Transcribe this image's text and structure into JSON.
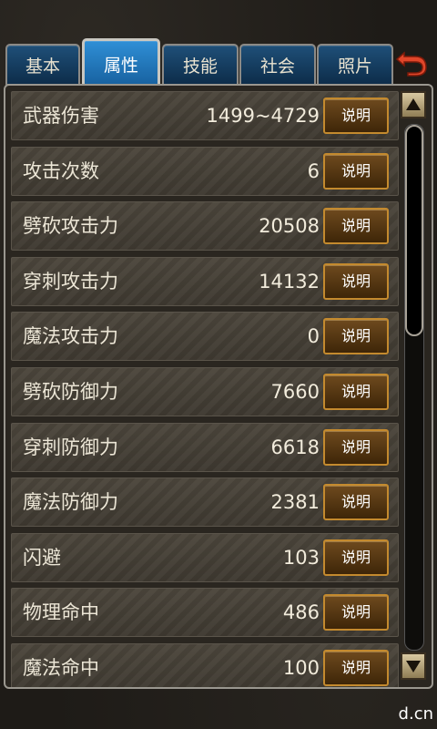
{
  "tabs": [
    {
      "label": "基本"
    },
    {
      "label": "属性"
    },
    {
      "label": "技能"
    },
    {
      "label": "社会"
    },
    {
      "label": "照片"
    }
  ],
  "active_tab": "属性",
  "explain_label": "说明",
  "attributes": [
    {
      "label": "武器伤害",
      "value": "1499~4729"
    },
    {
      "label": "攻击次数",
      "value": "6"
    },
    {
      "label": "劈砍攻击力",
      "value": "20508"
    },
    {
      "label": "穿刺攻击力",
      "value": "14132"
    },
    {
      "label": "魔法攻击力",
      "value": "0"
    },
    {
      "label": "劈砍防御力",
      "value": "7660"
    },
    {
      "label": "穿刺防御力",
      "value": "6618"
    },
    {
      "label": "魔法防御力",
      "value": "2381"
    },
    {
      "label": "闪避",
      "value": "103"
    },
    {
      "label": "物理命中",
      "value": "486"
    },
    {
      "label": "魔法命中",
      "value": "100"
    }
  ],
  "watermark": "d.cn",
  "icons": {
    "back": "return-arrow-icon",
    "scroll_up": "arrow-up-icon",
    "scroll_down": "arrow-down-icon"
  },
  "colors": {
    "tab_active": "#2f8fd6",
    "tab": "#1f4f78",
    "explain_border": "#c48a2e",
    "back_arrow": "#e0462a"
  }
}
